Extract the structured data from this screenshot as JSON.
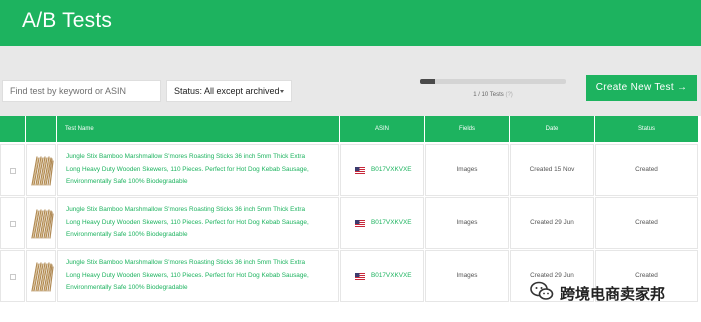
{
  "header": {
    "title": "A/B Tests"
  },
  "toolbar": {
    "search_placeholder": "Find test by keyword or ASIN",
    "status_filter": "Status: All except archived",
    "progress_fraction": 0.1,
    "tests_count": "1 / 10 Tests",
    "tests_count_extra": "(?)",
    "create_button": "Create New Test →"
  },
  "table": {
    "headers": {
      "test_name": "Test Name",
      "asin": "ASIN",
      "fields": "Fields",
      "date": "Date",
      "status": "Status"
    },
    "rows": [
      {
        "name_line1": "Jungle Stix Bamboo Marshmallow S'mores Roasting Sticks 36 inch 5mm Thick Extra",
        "name_line2": "Long Heavy Duty Wooden Skewers, 110 Pieces. Perfect for Hot Dog Kebab Sausage,",
        "name_line3": "Environmentally Safe 100% Biodegradable",
        "asin": "B017VXKVXE",
        "fields": "Images",
        "date": "Created 15 Nov",
        "status": "Created"
      },
      {
        "name_line1": "Jungle Stix Bamboo Marshmallow S'mores Roasting Sticks 36 inch 5mm Thick Extra",
        "name_line2": "Long Heavy Duty Wooden Skewers, 110 Pieces. Perfect for Hot Dog Kebab Sausage,",
        "name_line3": "Environmentally Safe 100% Biodegradable",
        "asin": "B017VXKVXE",
        "fields": "Images",
        "date": "Created 29 Jun",
        "status": "Created"
      },
      {
        "name_line1": "Jungle Stix Bamboo Marshmallow S'mores Roasting Sticks 36 inch 5mm Thick Extra",
        "name_line2": "Long Heavy Duty Wooden Skewers, 110 Pieces. Perfect for Hot Dog Kebab Sausage,",
        "name_line3": "Environmentally Safe 100% Biodegradable",
        "asin": "B017VXKVXE",
        "fields": "Images",
        "date": "Created 29 Jun",
        "status": "Created"
      }
    ]
  },
  "watermark": {
    "text": "跨境电商卖家邦"
  },
  "colors": {
    "brand_green": "#1db35f",
    "toolbar_gray": "#e8e8e8"
  },
  "icons": {
    "flag": "us-flag-icon",
    "thumbnail": "bamboo-skewers-image",
    "watermark": "wechat-logo-icon"
  }
}
